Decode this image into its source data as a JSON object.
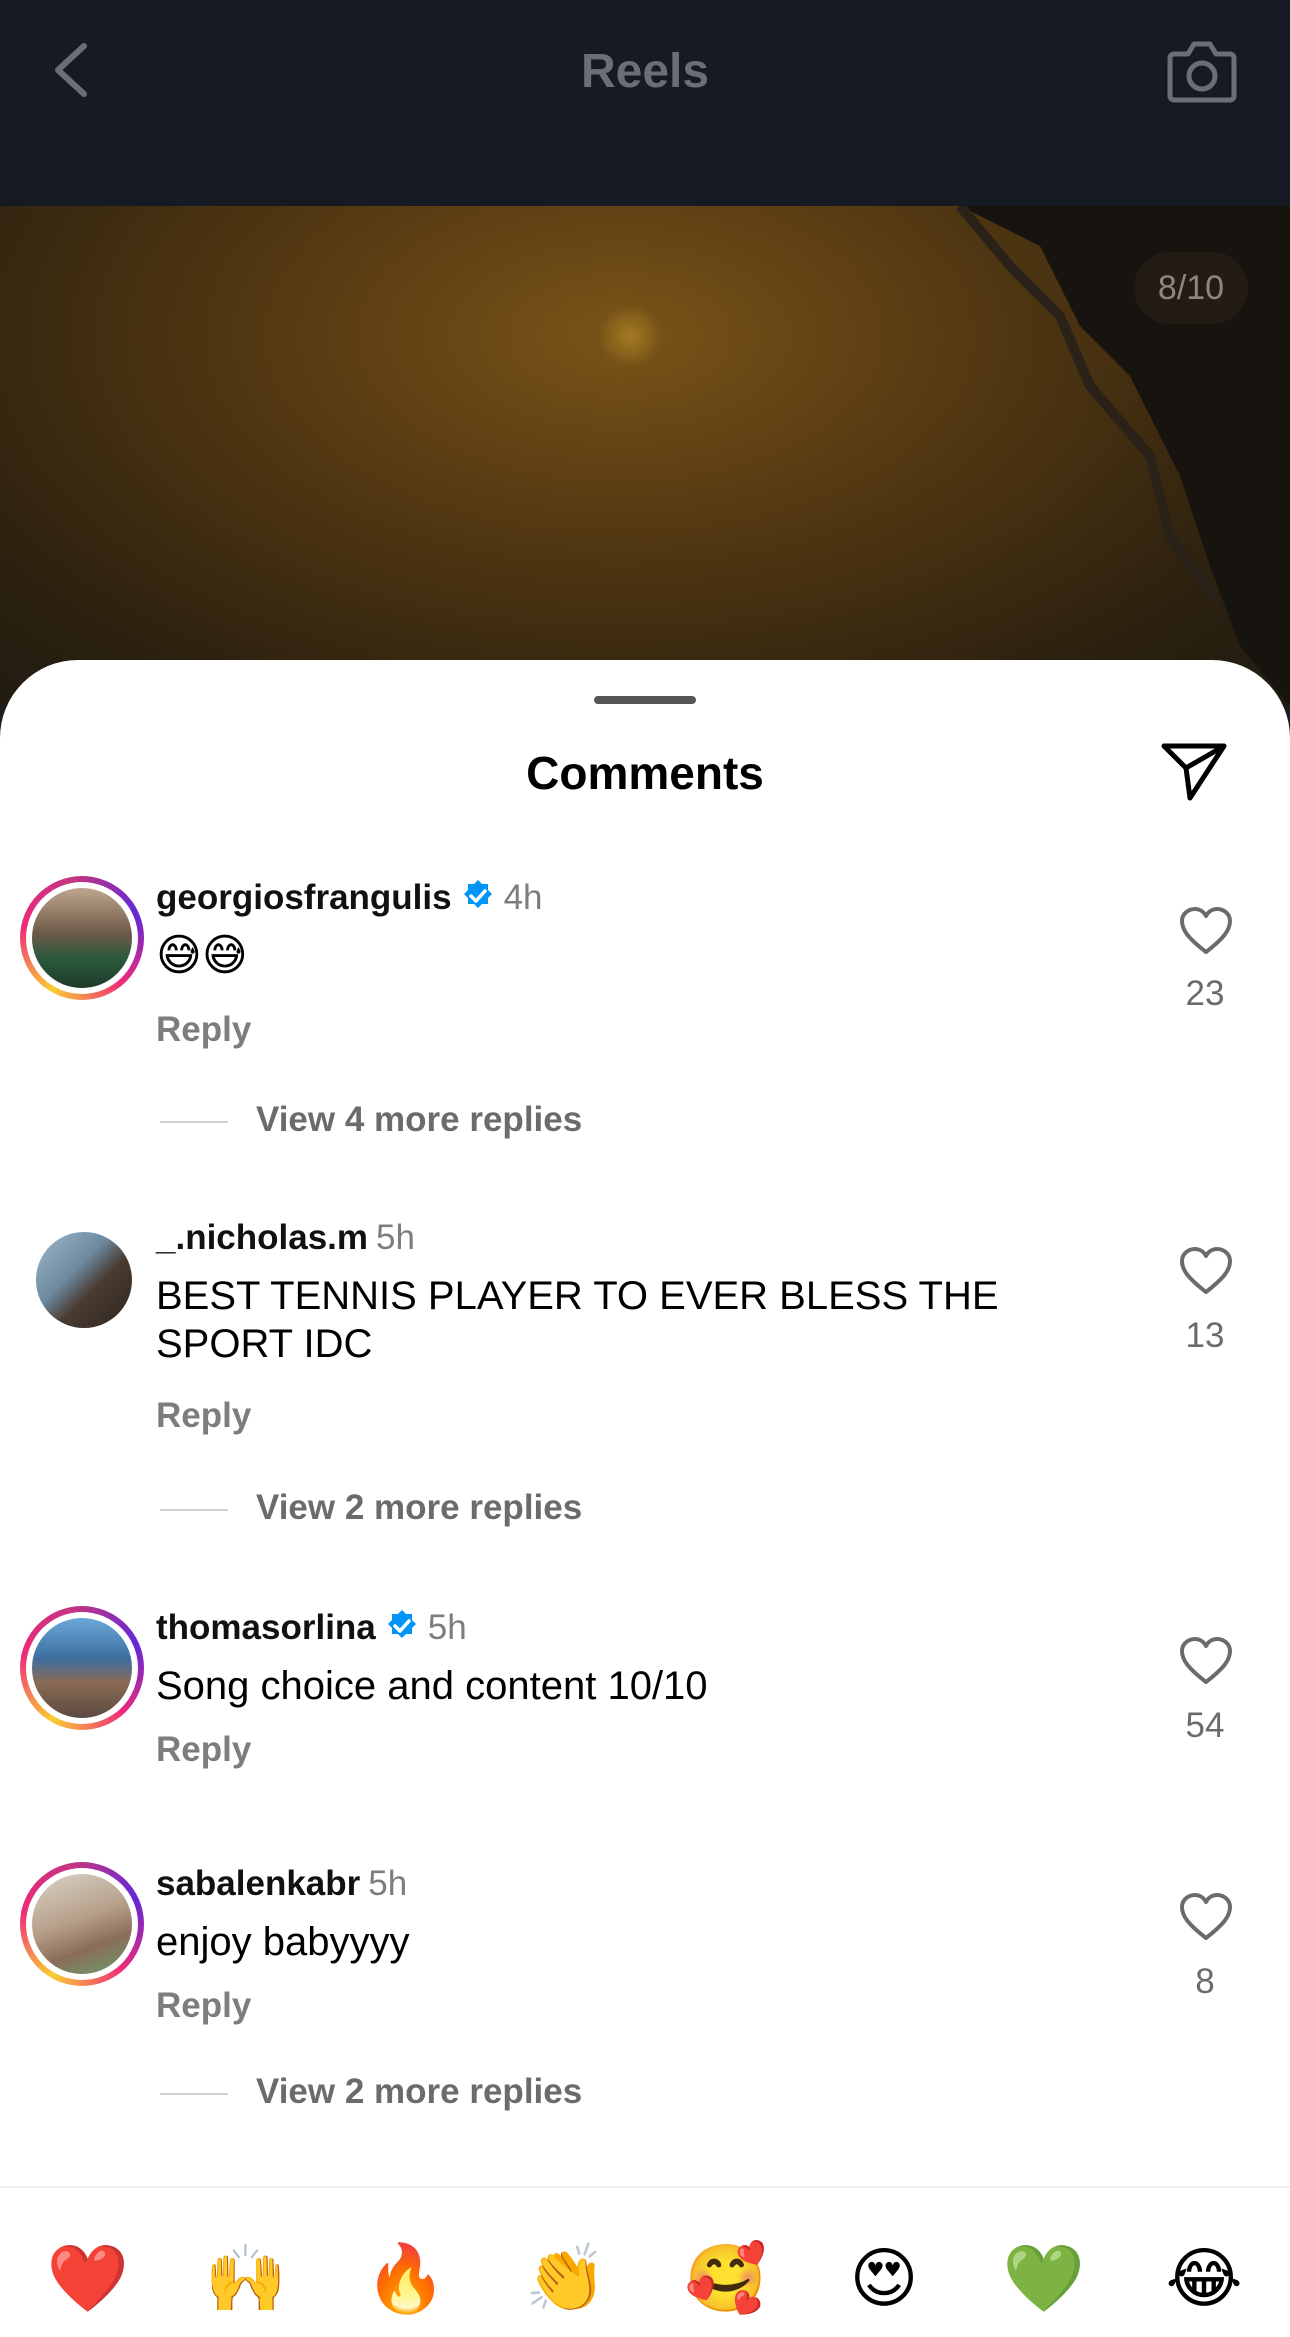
{
  "header": {
    "title": "Reels"
  },
  "video": {
    "counter": "8/10"
  },
  "sheet": {
    "title": "Comments"
  },
  "comments": [
    {
      "username": "georgiosfrangulis",
      "verified": true,
      "time": "4h",
      "text": "😅😅",
      "reply_label": "Reply",
      "likes": "23",
      "more_replies": "View 4 more replies"
    },
    {
      "username": "_.nicholas.m",
      "verified": false,
      "time": "5h",
      "text": "BEST TENNIS PLAYER TO EVER BLESS THE SPORT IDC",
      "reply_label": "Reply",
      "likes": "13",
      "more_replies": "View 2 more replies"
    },
    {
      "username": "thomasorlina",
      "verified": true,
      "time": "5h",
      "text": "Song choice and content 10/10",
      "reply_label": "Reply",
      "likes": "54"
    },
    {
      "username": "sabalenkabr",
      "verified": false,
      "time": "5h",
      "text": "enjoy babyyyy",
      "reply_label": "Reply",
      "likes": "8",
      "more_replies": "View 2 more replies"
    }
  ],
  "emoji_bar": [
    "❤️",
    "🙌",
    "🔥",
    "👏",
    "🥰",
    "😍",
    "💚",
    "😂"
  ],
  "icons": {
    "back": "chevron-left-icon",
    "camera": "camera-icon",
    "share": "paper-plane-icon",
    "like": "heart-outline-icon",
    "verified": "verified-badge-icon"
  },
  "colors": {
    "verified": "#0095f6",
    "muted_text": "#7d7d7d"
  }
}
